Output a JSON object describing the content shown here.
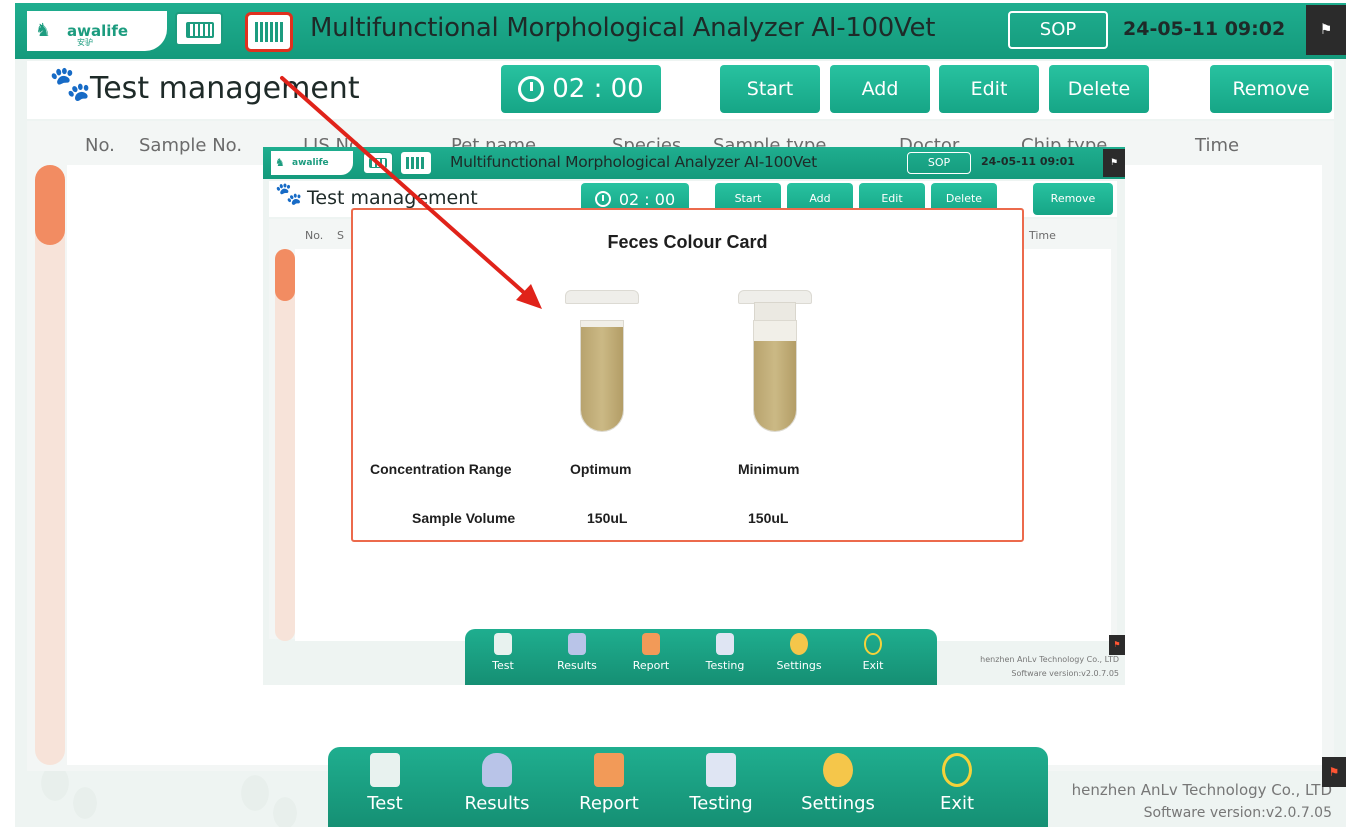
{
  "outer": {
    "brand": {
      "name": "awalife",
      "sub": "安驴"
    },
    "title": "Multifunctional Morphological Analyzer AI-100Vet",
    "sop_label": "SOP",
    "datetime": "24-05-11 09:02",
    "page_title": "Test management",
    "timer": "02 : 00",
    "toolbar": {
      "start": "Start",
      "add": "Add",
      "edit": "Edit",
      "delete": "Delete",
      "remove": "Remove"
    },
    "columns": [
      "No.",
      "Sample No.",
      "LIS No.",
      "Pet name",
      "Species",
      "Sample type",
      "Doctor",
      "Chip type",
      "Time"
    ],
    "dock": [
      {
        "label": "Test",
        "icon": "test-icon"
      },
      {
        "label": "Results",
        "icon": "results-icon"
      },
      {
        "label": "Report",
        "icon": "report-icon"
      },
      {
        "label": "Testing",
        "icon": "testing-icon"
      },
      {
        "label": "Settings",
        "icon": "settings-icon"
      },
      {
        "label": "Exit",
        "icon": "exit-icon"
      }
    ],
    "footer": {
      "company": "henzhen AnLv Technology Co., LTD",
      "version": "Software version:v2.0.7.05"
    }
  },
  "inner": {
    "brand": {
      "name": "awalife"
    },
    "title": "Multifunctional Morphological Analyzer AI-100Vet",
    "sop_label": "SOP",
    "datetime": "24-05-11 09:01",
    "page_title": "Test management",
    "timer": "02 : 00",
    "toolbar": {
      "start": "Start",
      "add": "Add",
      "edit": "Edit",
      "delete": "Delete",
      "remove": "Remove"
    },
    "columns": {
      "no": "No.",
      "s": "S",
      "time": "Time"
    },
    "dock": [
      "Test",
      "Results",
      "Report",
      "Testing",
      "Settings",
      "Exit"
    ],
    "footer": {
      "company": "henzhen AnLv Technology Co., LTD",
      "version": "Software version:v2.0.7.05"
    }
  },
  "colour_card": {
    "title": "Feces Colour Card",
    "row_concentration": "Concentration Range",
    "row_volume": "Sample Volume",
    "optimum": {
      "label": "Optimum",
      "volume": "150uL"
    },
    "minimum": {
      "label": "Minimum",
      "volume": "150uL"
    }
  },
  "colors": {
    "brand": "#1c9c7f",
    "accent_border": "#e0301e",
    "card_border": "#ec6a4c",
    "scroll_thumb": "#f28c62"
  }
}
